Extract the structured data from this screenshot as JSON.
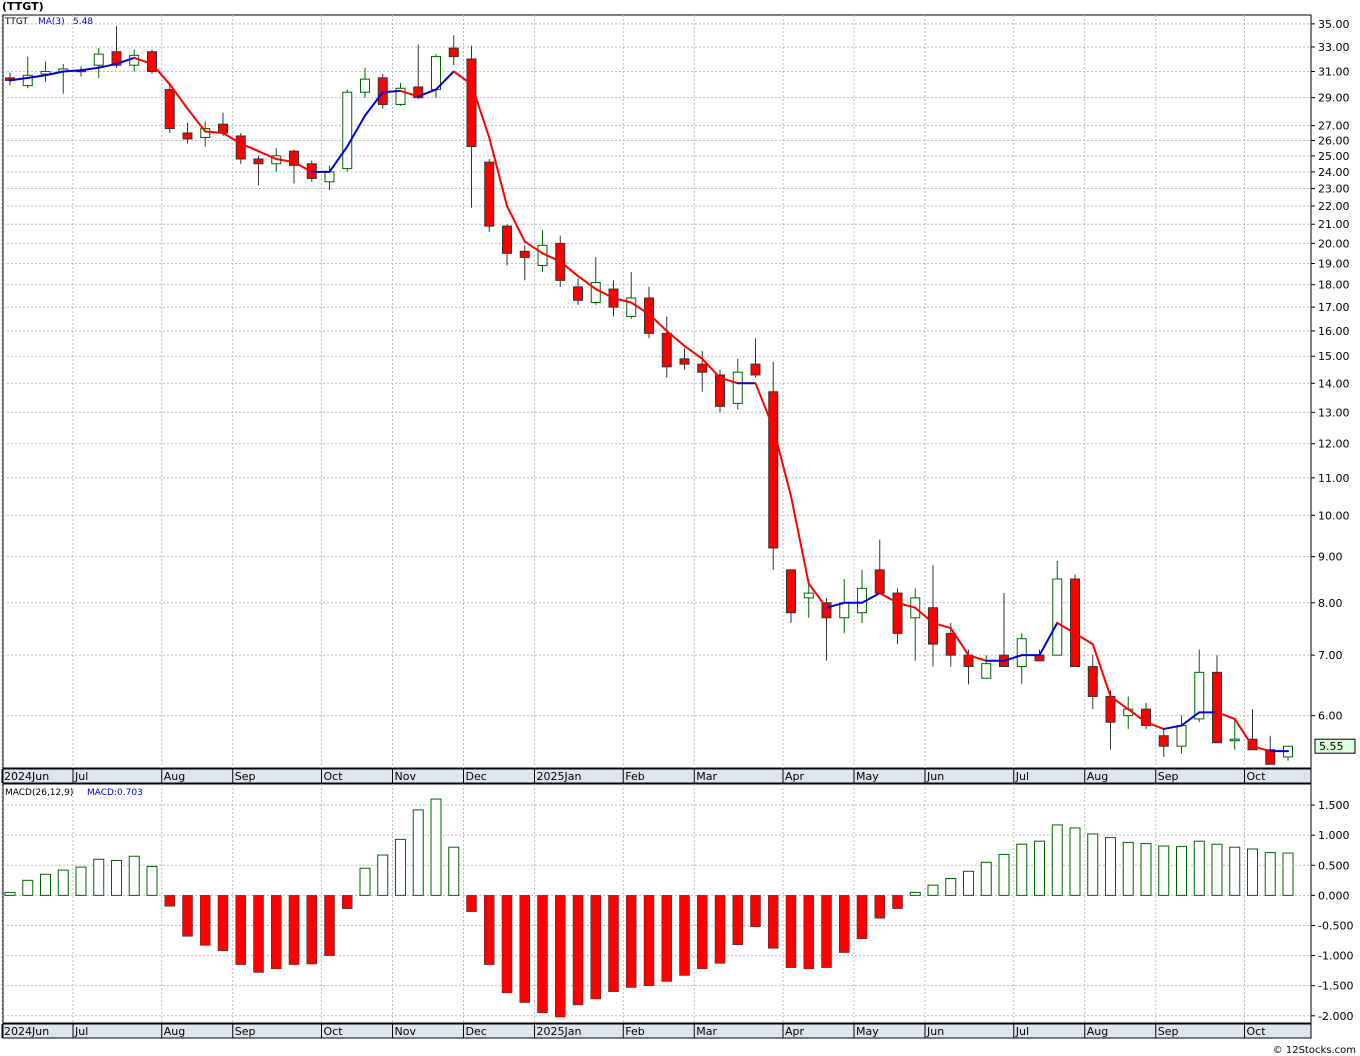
{
  "title": "(TTGT)",
  "credit": "© 12Stocks.com",
  "price_panel": {
    "legend_ticker": "TTGT",
    "legend_ma_label": "MA(3)",
    "legend_ma_value": "5.48",
    "last_price_label": "5.55"
  },
  "macd_panel": {
    "legend_label": "MACD(26,12,9)",
    "legend_value": "MACD:0.703"
  },
  "colors": {
    "up": "#006400",
    "down": "#ff0000",
    "ma_up": "#0000dd",
    "ma_down": "#ff0000",
    "grid": "#bbbbbb",
    "axis_bar": "#dde6ee"
  },
  "chart_data": [
    {
      "type": "candlestick",
      "title": "",
      "scale": "log",
      "y_ticks": [
        "35.00",
        "33.00",
        "31.00",
        "29.00",
        "27.00",
        "26.00",
        "25.00",
        "24.00",
        "23.00",
        "22.00",
        "21.00",
        "20.00",
        "19.00",
        "18.00",
        "17.00",
        "16.00",
        "15.00",
        "14.00",
        "13.00",
        "12.00",
        "11.00",
        "10.00",
        "9.00",
        "8.00",
        "7.00",
        "6.00"
      ],
      "x_labels": [
        "2024Jun",
        "Jul",
        "Aug",
        "Sep",
        "Oct",
        "Nov",
        "Dec",
        "2025Jan",
        "Feb",
        "Mar",
        "Apr",
        "May",
        "Jun",
        "Jul",
        "Aug",
        "Sep",
        "Oct"
      ],
      "candles": [
        {
          "o": 30.5,
          "h": 30.9,
          "l": 29.9,
          "c": 30.3
        },
        {
          "o": 29.9,
          "h": 32.2,
          "l": 29.7,
          "c": 30.7
        },
        {
          "o": 30.8,
          "h": 31.8,
          "l": 30.2,
          "c": 31.0
        },
        {
          "o": 31.0,
          "h": 31.6,
          "l": 29.3,
          "c": 31.2
        },
        {
          "o": 31.1,
          "h": 31.4,
          "l": 30.6,
          "c": 31.0
        },
        {
          "o": 31.5,
          "h": 32.9,
          "l": 30.5,
          "c": 32.4
        },
        {
          "o": 32.6,
          "h": 34.8,
          "l": 31.3,
          "c": 31.5
        },
        {
          "o": 31.5,
          "h": 32.8,
          "l": 31.0,
          "c": 32.3
        },
        {
          "o": 32.6,
          "h": 32.8,
          "l": 30.8,
          "c": 31.0
        },
        {
          "o": 29.6,
          "h": 30.1,
          "l": 26.5,
          "c": 26.8
        },
        {
          "o": 26.5,
          "h": 27.2,
          "l": 25.8,
          "c": 26.1
        },
        {
          "o": 26.2,
          "h": 27.3,
          "l": 25.6,
          "c": 26.8
        },
        {
          "o": 27.1,
          "h": 27.9,
          "l": 26.3,
          "c": 26.5
        },
        {
          "o": 26.3,
          "h": 26.5,
          "l": 24.5,
          "c": 24.8
        },
        {
          "o": 24.8,
          "h": 25.0,
          "l": 23.2,
          "c": 24.5
        },
        {
          "o": 24.5,
          "h": 25.5,
          "l": 24.0,
          "c": 25.0
        },
        {
          "o": 25.3,
          "h": 25.4,
          "l": 23.3,
          "c": 24.4
        },
        {
          "o": 24.5,
          "h": 24.7,
          "l": 23.4,
          "c": 23.6
        },
        {
          "o": 23.4,
          "h": 24.4,
          "l": 22.9,
          "c": 24.0
        },
        {
          "o": 24.2,
          "h": 29.6,
          "l": 24.0,
          "c": 29.4
        },
        {
          "o": 29.4,
          "h": 31.3,
          "l": 29.0,
          "c": 30.4
        },
        {
          "o": 30.5,
          "h": 30.8,
          "l": 28.2,
          "c": 28.5
        },
        {
          "o": 28.5,
          "h": 30.1,
          "l": 28.4,
          "c": 29.7
        },
        {
          "o": 29.8,
          "h": 33.2,
          "l": 28.9,
          "c": 29.0
        },
        {
          "o": 29.6,
          "h": 32.4,
          "l": 29.0,
          "c": 32.2
        },
        {
          "o": 32.9,
          "h": 34.0,
          "l": 31.5,
          "c": 32.2
        },
        {
          "o": 32.0,
          "h": 33.1,
          "l": 21.9,
          "c": 25.6
        },
        {
          "o": 24.6,
          "h": 24.8,
          "l": 20.6,
          "c": 20.9
        },
        {
          "o": 20.9,
          "h": 21.0,
          "l": 18.9,
          "c": 19.5
        },
        {
          "o": 19.6,
          "h": 19.9,
          "l": 18.2,
          "c": 19.3
        },
        {
          "o": 18.9,
          "h": 20.7,
          "l": 18.6,
          "c": 19.9
        },
        {
          "o": 20.0,
          "h": 20.4,
          "l": 17.9,
          "c": 18.2
        },
        {
          "o": 17.9,
          "h": 18.3,
          "l": 17.1,
          "c": 17.3
        },
        {
          "o": 17.2,
          "h": 19.3,
          "l": 17.1,
          "c": 18.1
        },
        {
          "o": 17.8,
          "h": 18.2,
          "l": 16.6,
          "c": 17.0
        },
        {
          "o": 16.6,
          "h": 18.6,
          "l": 16.5,
          "c": 17.4
        },
        {
          "o": 17.4,
          "h": 17.9,
          "l": 15.7,
          "c": 15.9
        },
        {
          "o": 15.9,
          "h": 16.6,
          "l": 14.2,
          "c": 14.6
        },
        {
          "o": 14.9,
          "h": 15.3,
          "l": 14.5,
          "c": 14.7
        },
        {
          "o": 14.7,
          "h": 15.2,
          "l": 13.7,
          "c": 14.4
        },
        {
          "o": 14.3,
          "h": 14.5,
          "l": 13.0,
          "c": 13.2
        },
        {
          "o": 13.3,
          "h": 14.9,
          "l": 13.1,
          "c": 14.4
        },
        {
          "o": 14.7,
          "h": 15.7,
          "l": 14.2,
          "c": 14.3
        },
        {
          "o": 13.7,
          "h": 14.8,
          "l": 8.7,
          "c": 9.2
        },
        {
          "o": 8.7,
          "h": 8.7,
          "l": 7.6,
          "c": 7.8
        },
        {
          "o": 8.1,
          "h": 8.5,
          "l": 7.7,
          "c": 8.2
        },
        {
          "o": 8.0,
          "h": 8.1,
          "l": 6.9,
          "c": 7.7
        },
        {
          "o": 7.7,
          "h": 8.5,
          "l": 7.4,
          "c": 8.0
        },
        {
          "o": 7.8,
          "h": 8.7,
          "l": 7.6,
          "c": 8.3
        },
        {
          "o": 8.7,
          "h": 9.4,
          "l": 8.2,
          "c": 8.2
        },
        {
          "o": 8.2,
          "h": 8.3,
          "l": 7.2,
          "c": 7.4
        },
        {
          "o": 7.7,
          "h": 8.3,
          "l": 6.9,
          "c": 8.1
        },
        {
          "o": 7.9,
          "h": 8.8,
          "l": 6.8,
          "c": 7.2
        },
        {
          "o": 7.4,
          "h": 7.6,
          "l": 6.8,
          "c": 7.0
        },
        {
          "o": 7.0,
          "h": 7.1,
          "l": 6.5,
          "c": 6.8
        },
        {
          "o": 6.6,
          "h": 7.0,
          "l": 6.6,
          "c": 6.85
        },
        {
          "o": 7.0,
          "h": 8.2,
          "l": 6.8,
          "c": 6.8
        },
        {
          "o": 6.8,
          "h": 7.4,
          "l": 6.5,
          "c": 7.3
        },
        {
          "o": 7.0,
          "h": 7.1,
          "l": 6.9,
          "c": 6.9
        },
        {
          "o": 7.0,
          "h": 8.9,
          "l": 7.0,
          "c": 8.5
        },
        {
          "o": 8.5,
          "h": 8.6,
          "l": 6.8,
          "c": 6.8
        },
        {
          "o": 6.8,
          "h": 7.0,
          "l": 6.1,
          "c": 6.3
        },
        {
          "o": 6.3,
          "h": 6.4,
          "l": 5.5,
          "c": 5.9
        },
        {
          "o": 6.0,
          "h": 6.3,
          "l": 5.8,
          "c": 6.1
        },
        {
          "o": 6.1,
          "h": 6.2,
          "l": 5.8,
          "c": 5.85
        },
        {
          "o": 5.7,
          "h": 5.8,
          "l": 5.4,
          "c": 5.55
        },
        {
          "o": 5.55,
          "h": 6.0,
          "l": 5.45,
          "c": 5.85
        },
        {
          "o": 5.95,
          "h": 7.1,
          "l": 5.9,
          "c": 6.7
        },
        {
          "o": 6.7,
          "h": 7.0,
          "l": 5.6,
          "c": 5.6
        },
        {
          "o": 5.65,
          "h": 5.95,
          "l": 5.5,
          "c": 5.65
        },
        {
          "o": 5.65,
          "h": 6.1,
          "l": 5.5,
          "c": 5.5
        },
        {
          "o": 5.5,
          "h": 5.7,
          "l": 5.35,
          "c": 5.3
        },
        {
          "o": 5.4,
          "h": 5.55,
          "l": 5.35,
          "c": 5.55
        }
      ],
      "ma3": [
        30.3,
        30.5,
        30.7,
        31.0,
        31.1,
        31.3,
        31.6,
        32.1,
        31.6,
        30.0,
        28.2,
        26.6,
        26.5,
        25.8,
        25.3,
        24.8,
        24.6,
        24.0,
        24.0,
        25.6,
        27.7,
        29.4,
        29.5,
        29.1,
        29.6,
        31.0,
        30.0,
        26.2,
        22.0,
        20.1,
        19.5,
        19.1,
        18.4,
        17.8,
        17.4,
        17.2,
        16.7,
        16.0,
        15.4,
        14.9,
        14.2,
        14.0,
        14.0,
        12.5,
        10.5,
        8.4,
        7.9,
        8.0,
        8.0,
        8.2,
        8.0,
        7.9,
        7.6,
        7.5,
        7.0,
        6.9,
        6.9,
        7.0,
        7.0,
        7.6,
        7.4,
        7.2,
        6.3,
        6.1,
        5.9,
        5.8,
        5.85,
        6.05,
        6.05,
        5.95,
        5.55,
        5.48,
        5.48
      ]
    },
    {
      "type": "bar",
      "title": "",
      "y_ticks": [
        "1.500",
        "1.000",
        "0.500",
        "0.000",
        "-0.500",
        "-1.000",
        "-1.500",
        "-2.000"
      ],
      "x_labels": [
        "2024Jun",
        "Jul",
        "Aug",
        "Sep",
        "Oct",
        "Nov",
        "Dec",
        "2025Jan",
        "Feb",
        "Mar",
        "Apr",
        "May",
        "Jun",
        "Jul",
        "Aug",
        "Sep",
        "Oct"
      ],
      "values": [
        0.05,
        0.25,
        0.35,
        0.42,
        0.47,
        0.6,
        0.58,
        0.65,
        0.48,
        -0.18,
        -0.68,
        -0.83,
        -0.92,
        -1.15,
        -1.28,
        -1.22,
        -1.15,
        -1.14,
        -1.0,
        -0.22,
        0.45,
        0.67,
        0.93,
        1.42,
        1.6,
        0.8,
        -0.27,
        -1.15,
        -1.62,
        -1.78,
        -1.95,
        -2.02,
        -1.82,
        -1.72,
        -1.6,
        -1.53,
        -1.5,
        -1.43,
        -1.33,
        -1.22,
        -1.13,
        -0.82,
        -0.52,
        -0.88,
        -1.2,
        -1.22,
        -1.2,
        -0.95,
        -0.72,
        -0.38,
        -0.22,
        0.05,
        0.17,
        0.28,
        0.4,
        0.55,
        0.68,
        0.85,
        0.9,
        1.17,
        1.12,
        1.02,
        0.96,
        0.88,
        0.86,
        0.82,
        0.81,
        0.9,
        0.85,
        0.8,
        0.77,
        0.71,
        0.703
      ]
    }
  ]
}
